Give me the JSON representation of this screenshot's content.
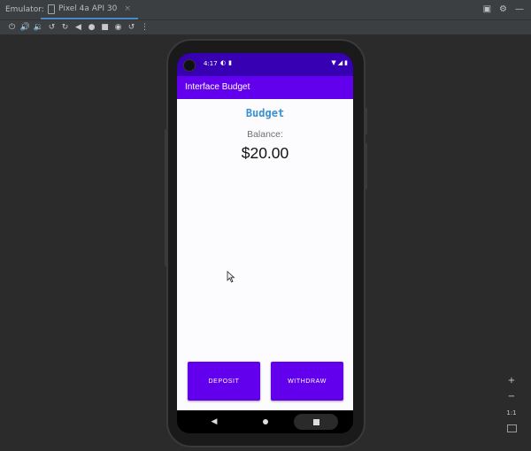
{
  "window": {
    "emulator_label": "Emulator:",
    "device_tab": "Pixel 4a API 30",
    "tab_close": "×"
  },
  "toolbar_icons": [
    "power-icon",
    "volume-up-icon",
    "volume-down-icon",
    "rotate-left-icon",
    "rotate-right-icon",
    "back-icon",
    "home-icon",
    "overview-icon",
    "screenshot-icon",
    "snapshot-icon",
    "more-icon"
  ],
  "status_bar": {
    "time": "4:17"
  },
  "app": {
    "bar_title": "Interface Budget",
    "title": "Budget",
    "balance_label": "Balance:",
    "balance_value": "$20.00",
    "deposit_label": "DEPOSIT",
    "withdraw_label": "WITHDRAW"
  },
  "zoom": {
    "zoom_in": "+",
    "zoom_out": "−",
    "ratio": "1:1"
  },
  "colors": {
    "status_bar": "#3700b3",
    "app_bar": "#6200ee",
    "button": "#6200ee",
    "title_accent": "#3a8fd0"
  }
}
